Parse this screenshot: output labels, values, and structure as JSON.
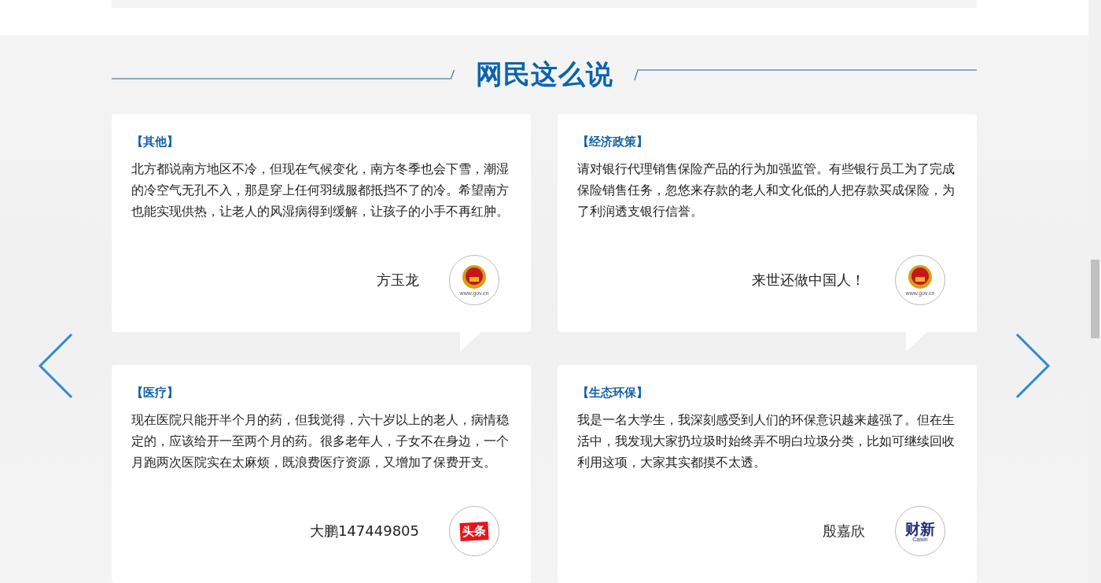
{
  "section": {
    "title": "网民这么说"
  },
  "cards": [
    {
      "category": "【其他】",
      "text": "北方都说南方地区不冷，但现在气候变化，南方冬季也会下雪，潮湿的冷空气无孔不入，那是穿上任何羽绒服都抵挡不了的冷。希望南方也能实现供热，让老人的风湿病得到缓解，让孩子的小手不再红肿。",
      "author": "方玉龙",
      "source": {
        "kind": "gov",
        "text": "www.gov.cn"
      }
    },
    {
      "category": "【经济政策】",
      "text": "请对银行代理销售保险产品的行为加强监管。有些银行员工为了完成保险销售任务，忽悠来存款的老人和文化低的人把存款买成保险，为了利润透支银行信誉。",
      "author": "来世还做中国人！",
      "source": {
        "kind": "gov",
        "text": "www.gov.cn"
      }
    },
    {
      "category": "【医疗】",
      "text": "现在医院只能开半个月的药，但我觉得，六十岁以上的老人，病情稳定的，应该给开一至两个月的药。很多老年人，子女不在身边，一个月跑两次医院实在太麻烦，既浪费医疗资源，又增加了保费开支。",
      "author": "大鹏147449805",
      "source": {
        "kind": "toutiao",
        "text": "头条"
      }
    },
    {
      "category": "【生态环保】",
      "text": "我是一名大学生，我深刻感受到人们的环保意识越来越强了。但在生活中，我发现大家扔垃圾时始终弄不明白垃圾分类，比如可继续回收利用这项，大家其实都摸不太透。",
      "author": "殷嘉欣",
      "source": {
        "kind": "caixin",
        "text": "财新",
        "subtext": "Caixin"
      }
    }
  ]
}
